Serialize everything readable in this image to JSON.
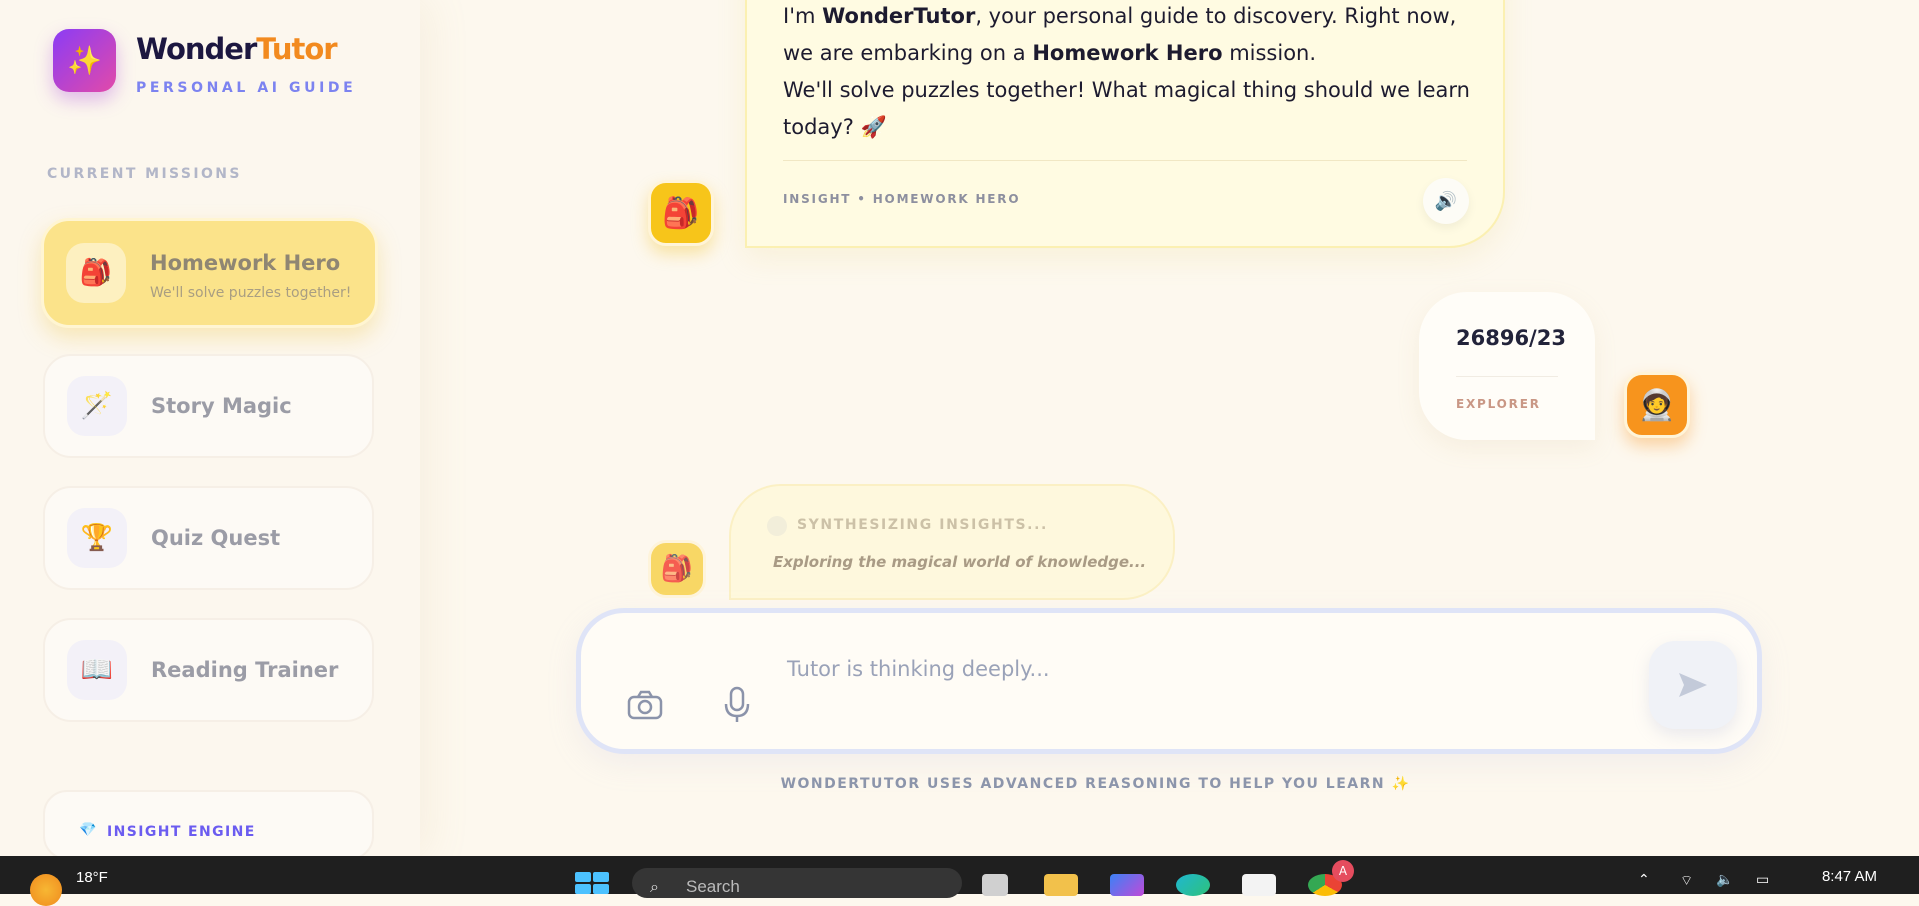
{
  "brand": {
    "name_part1": "Wonder",
    "name_part2": "Tutor",
    "subtitle": "PERSONAL AI GUIDE",
    "logo_icon": "sparkles-icon"
  },
  "sidebar": {
    "section_label": "CURRENT MISSIONS",
    "missions": [
      {
        "title": "Homework Hero",
        "subtitle": "We'll solve puzzles together!",
        "icon": "🎒",
        "active": true
      },
      {
        "title": "Story Magic",
        "icon": "🪄",
        "active": false
      },
      {
        "title": "Quiz Quest",
        "icon": "🏆",
        "active": false
      },
      {
        "title": "Reading Trainer",
        "icon": "📖",
        "active": false
      }
    ],
    "insight_engine_label": "INSIGHT ENGINE"
  },
  "chat": {
    "tutor_message": {
      "line1_pre": "I'm ",
      "line1_bold": "WonderTutor",
      "line1_post": ", your personal guide to discovery. Right now, we are embarking on a ",
      "mission_bold": "Homework Hero",
      "line1_end": " mission.",
      "line2": "We'll solve puzzles together! What magical thing should we learn today? 🚀",
      "meta": "INSIGHT • HOMEWORK HERO",
      "avatar": "🎒"
    },
    "user_message": {
      "text": "26896/23",
      "sender": "EXPLORER",
      "avatar": "🧑‍🚀"
    },
    "thinking": {
      "status": "SYNTHESIZING INSIGHTS...",
      "detail": "Exploring the magical world of knowledge...",
      "avatar": "🎒"
    }
  },
  "composer": {
    "placeholder": "Tutor is thinking deeply..."
  },
  "footnote": "WONDERTUTOR USES ADVANCED REASONING TO HELP YOU LEARN ✨",
  "taskbar": {
    "temperature": "18°F",
    "search_placeholder": "Search",
    "time": "8:47 AM",
    "badge": "A"
  },
  "colors": {
    "accent_orange": "#f28a1f",
    "accent_purple": "#7c83f0",
    "active_mission": "#fbe38a",
    "tutor_bubble": "#fffbe2"
  }
}
